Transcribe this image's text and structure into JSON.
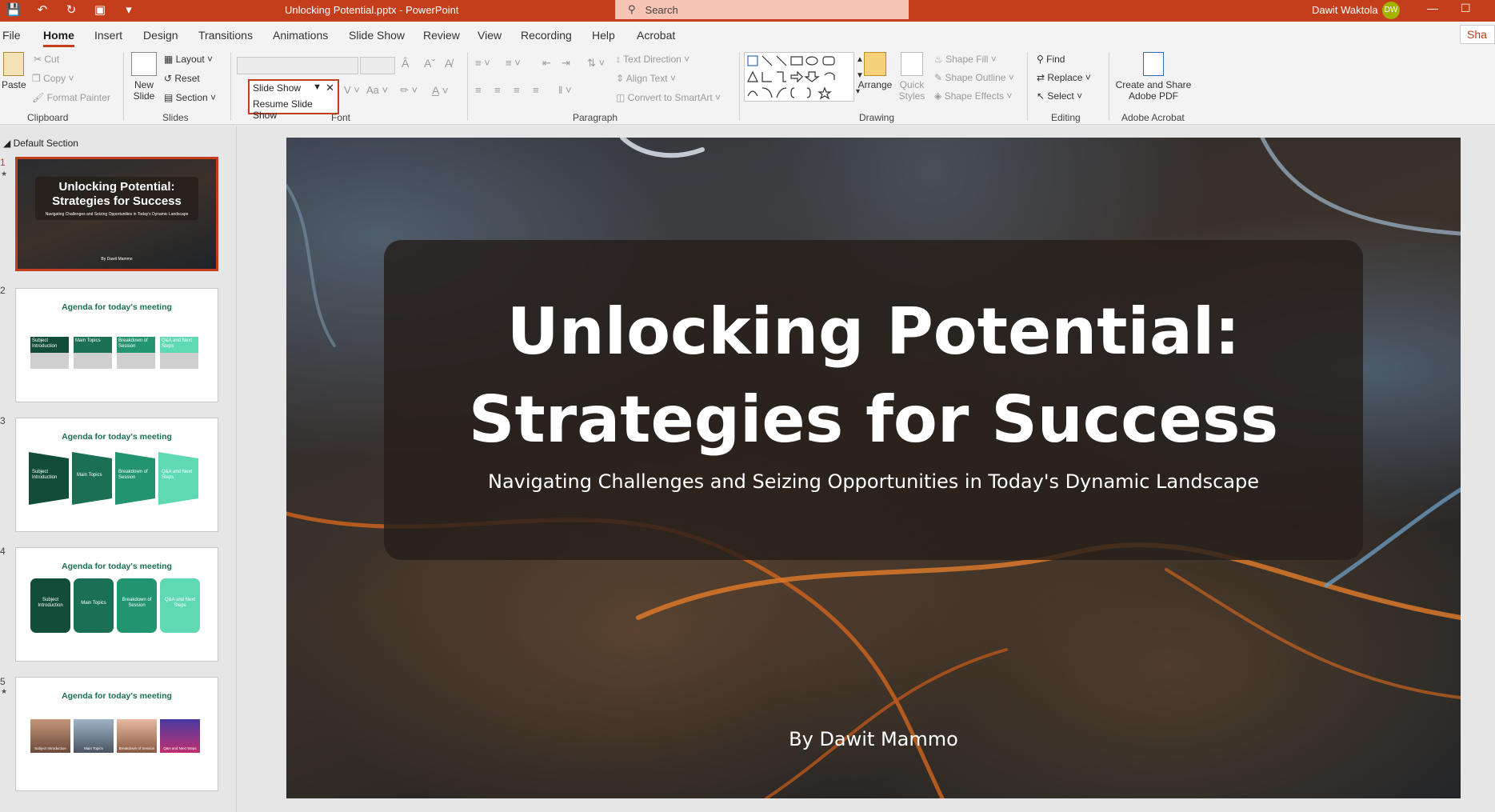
{
  "window": {
    "title": "Unlocking Potential.pptx - PowerPoint",
    "search_placeholder": "Search",
    "user_name": "Dawit Waktola",
    "user_initials": "DW",
    "share_label": "Sha"
  },
  "tabs": [
    "File",
    "Home",
    "Insert",
    "Design",
    "Transitions",
    "Animations",
    "Slide Show",
    "Review",
    "View",
    "Recording",
    "Help",
    "Acrobat"
  ],
  "ribbon": {
    "clipboard": {
      "paste": "Paste",
      "cut": "Cut",
      "copy": "Copy",
      "format_painter": "Format Painter",
      "label": "Clipboard"
    },
    "slides": {
      "new_slide": "New Slide",
      "layout": "Layout",
      "reset": "Reset",
      "section": "Section",
      "label": "Slides"
    },
    "font": {
      "label": "Font",
      "popup_title": "Slide Show",
      "popup_item": "Resume Slide Show"
    },
    "paragraph": {
      "text_direction": "Text Direction",
      "align_text": "Align Text",
      "convert_smartart": "Convert to SmartArt",
      "label": "Paragraph"
    },
    "drawing": {
      "arrange": "Arrange",
      "quick_styles": "Quick Styles",
      "shape_fill": "Shape Fill",
      "shape_outline": "Shape Outline",
      "shape_effects": "Shape Effects",
      "label": "Drawing"
    },
    "editing": {
      "find": "Find",
      "replace": "Replace",
      "select": "Select",
      "label": "Editing"
    },
    "acrobat": {
      "create_share": "Create and Share Adobe PDF",
      "label": "Adobe Acrobat"
    }
  },
  "left_pane": {
    "section_name": "Default Section",
    "slides": [
      {
        "num": "1",
        "title": "Unlocking Potential: Strategies for Success",
        "subtitle": "Navigating Challenges and Seizing Opportunities in Today's Dynamic Landscape",
        "byline": "By Dawit Mammo"
      },
      {
        "num": "2",
        "title": "Agenda for today's meeting",
        "items": [
          "Subject Introduction",
          "Main Topics",
          "Breakdown of Session",
          "Q&A and Next Steps"
        ]
      },
      {
        "num": "3",
        "title": "Agenda for today's meeting",
        "items": [
          "Subject Introduction",
          "Main Topics",
          "Breakdown of Session",
          "Q&A and Next Steps"
        ]
      },
      {
        "num": "4",
        "title": "Agenda for today's meeting",
        "items": [
          "Subject Introduction",
          "Main Topics",
          "Breakdown of Session",
          "Q&A and Next Steps"
        ]
      },
      {
        "num": "5",
        "title": "Agenda for today's meeting",
        "items": [
          "Subject Introduction",
          "Main Topics",
          "Breakdown of Session",
          "Q&A and Next Steps"
        ]
      }
    ]
  },
  "slide": {
    "title_line1": "Unlocking Potential:",
    "title_line2": "Strategies for Success",
    "subtitle": "Navigating Challenges and Seizing Opportunities in Today's Dynamic Landscape",
    "byline": "By Dawit Mammo"
  },
  "colors": {
    "accent": "#c43e1c",
    "agenda_green": "#1b6f55",
    "teal_light": "#5fd9b4"
  }
}
